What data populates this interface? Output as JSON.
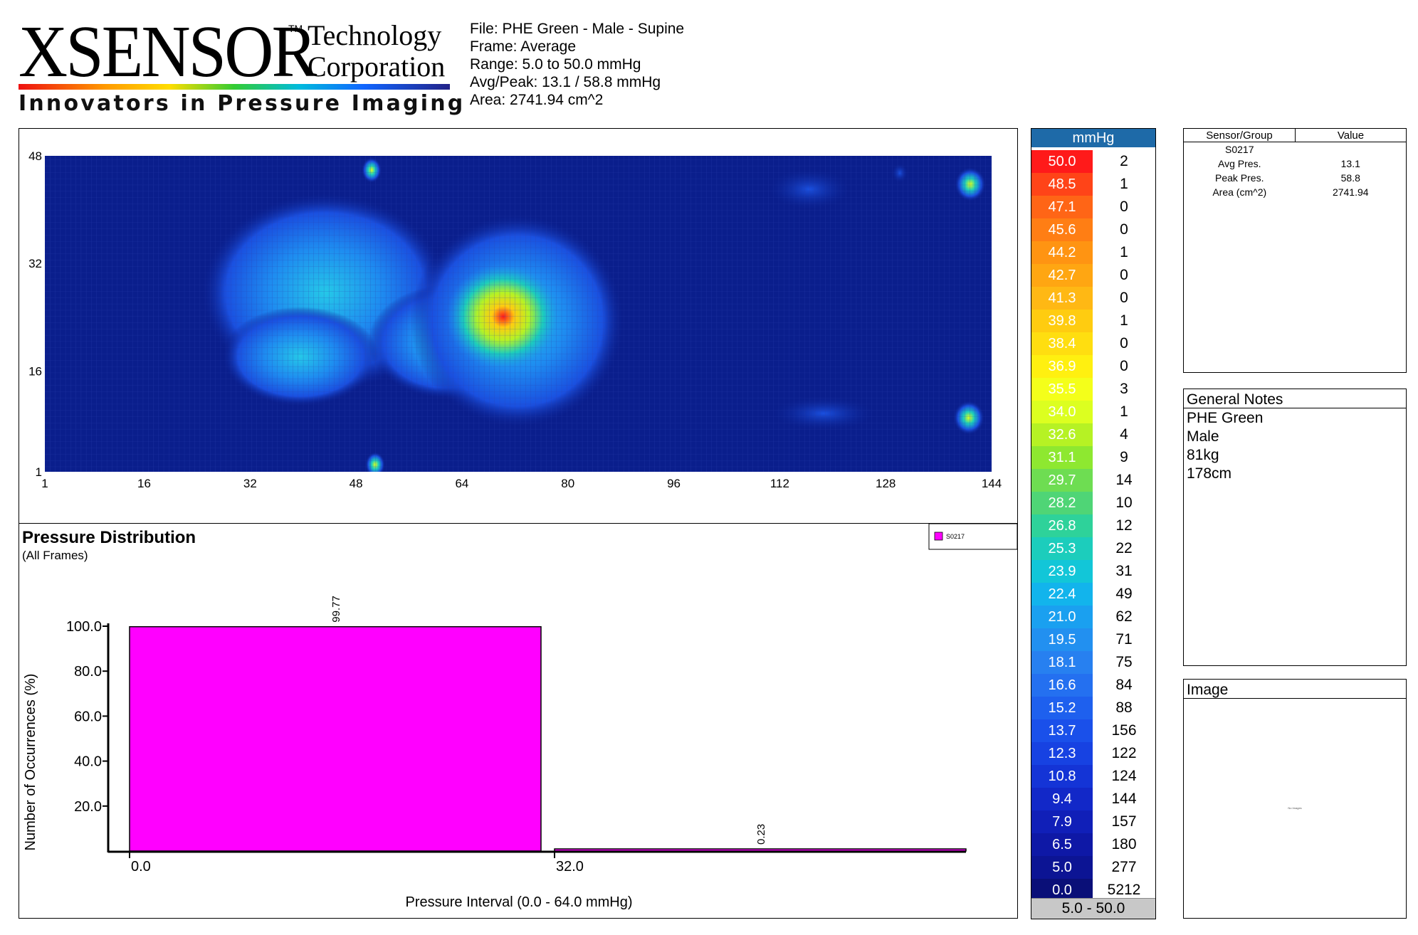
{
  "logo": {
    "word": "XSENSOR",
    "tm": "TM",
    "line1": "Technology",
    "line2": "Corporation",
    "tagline": "Innovators in Pressure Imaging"
  },
  "header": {
    "file": "File: PHE Green - Male - Supine",
    "frame": "Frame: Average",
    "range": "Range: 5.0 to 50.0 mmHg",
    "avg_peak": "Avg/Peak: 13.1 / 58.8 mmHg",
    "area": "Area: 2741.94 cm^2"
  },
  "pressure_map": {
    "x_ticks": [
      "1",
      "16",
      "32",
      "48",
      "64",
      "80",
      "96",
      "112",
      "128",
      "144"
    ],
    "y_ticks": [
      "48",
      "32",
      "16",
      "1"
    ],
    "background_color": "#0a1e8c"
  },
  "color_scale": {
    "unit": "mmHg",
    "footer": "5.0 - 50.0",
    "levels": [
      {
        "value": "50.0",
        "count": "2",
        "color": "#ff1a1a"
      },
      {
        "value": "48.5",
        "count": "1",
        "color": "#ff4418"
      },
      {
        "value": "47.1",
        "count": "0",
        "color": "#ff6516"
      },
      {
        "value": "45.6",
        "count": "0",
        "color": "#ff7e14"
      },
      {
        "value": "44.2",
        "count": "1",
        "color": "#ff9412"
      },
      {
        "value": "42.7",
        "count": "0",
        "color": "#ffa612"
      },
      {
        "value": "41.3",
        "count": "0",
        "color": "#ffb814"
      },
      {
        "value": "39.8",
        "count": "1",
        "color": "#ffcc10"
      },
      {
        "value": "38.4",
        "count": "0",
        "color": "#ffde10"
      },
      {
        "value": "36.9",
        "count": "0",
        "color": "#fff010"
      },
      {
        "value": "35.5",
        "count": "3",
        "color": "#f4ff1a"
      },
      {
        "value": "34.0",
        "count": "1",
        "color": "#dcff20"
      },
      {
        "value": "32.6",
        "count": "4",
        "color": "#b6f224"
      },
      {
        "value": "31.1",
        "count": "9",
        "color": "#8ee830"
      },
      {
        "value": "29.7",
        "count": "14",
        "color": "#6edd52"
      },
      {
        "value": "28.2",
        "count": "10",
        "color": "#4fd576"
      },
      {
        "value": "26.8",
        "count": "12",
        "color": "#2ed29a"
      },
      {
        "value": "25.3",
        "count": "22",
        "color": "#1ccdbc"
      },
      {
        "value": "23.9",
        "count": "31",
        "color": "#12c6d8"
      },
      {
        "value": "22.4",
        "count": "49",
        "color": "#12b4ec"
      },
      {
        "value": "21.0",
        "count": "62",
        "color": "#1aa0f0"
      },
      {
        "value": "19.5",
        "count": "71",
        "color": "#2290f0"
      },
      {
        "value": "18.1",
        "count": "75",
        "color": "#2780f0"
      },
      {
        "value": "16.6",
        "count": "84",
        "color": "#2470f0"
      },
      {
        "value": "15.2",
        "count": "88",
        "color": "#1e60ee"
      },
      {
        "value": "13.7",
        "count": "156",
        "color": "#1a50ea"
      },
      {
        "value": "12.3",
        "count": "122",
        "color": "#1742e2"
      },
      {
        "value": "10.8",
        "count": "124",
        "color": "#1434d6"
      },
      {
        "value": "9.4",
        "count": "144",
        "color": "#1228c8"
      },
      {
        "value": "7.9",
        "count": "157",
        "color": "#101fb8"
      },
      {
        "value": "6.5",
        "count": "180",
        "color": "#0e18a6"
      },
      {
        "value": "5.0",
        "count": "277",
        "color": "#0c1494"
      },
      {
        "value": "0.0",
        "count": "5212",
        "color": "#0a0f78"
      }
    ]
  },
  "sensor_table": {
    "col1": "Sensor/Group",
    "col2": "Value",
    "sensor": "S0217",
    "rows": [
      {
        "label": "Avg Pres.",
        "value": "13.1"
      },
      {
        "label": "Peak Pres.",
        "value": "58.8"
      },
      {
        "label": "Area (cm^2)",
        "value": "2741.94"
      }
    ]
  },
  "general_notes": {
    "title": "General Notes",
    "lines": [
      "PHE Green",
      "Male",
      "81kg",
      "178cm"
    ]
  },
  "image_panel": {
    "title": "Image",
    "placeholder": "No Images"
  },
  "chart_data": {
    "type": "bar",
    "title": "Pressure Distribution",
    "subtitle": "(All Frames)",
    "xlabel": "Pressure Interval (0.0 - 64.0 mmHg)",
    "ylabel": "Number of Occurrences (%)",
    "categories": [
      "0.0",
      "32.0"
    ],
    "series": [
      {
        "name": "S0217",
        "values": [
          99.77,
          0.23
        ],
        "color": "#ff00ff"
      }
    ],
    "data_labels": [
      "99.77",
      "0.23"
    ],
    "ylim": [
      0,
      100
    ],
    "y_ticks": [
      "100.0",
      "80.0",
      "60.0",
      "40.0",
      "20.0"
    ],
    "legend": "top-right"
  }
}
